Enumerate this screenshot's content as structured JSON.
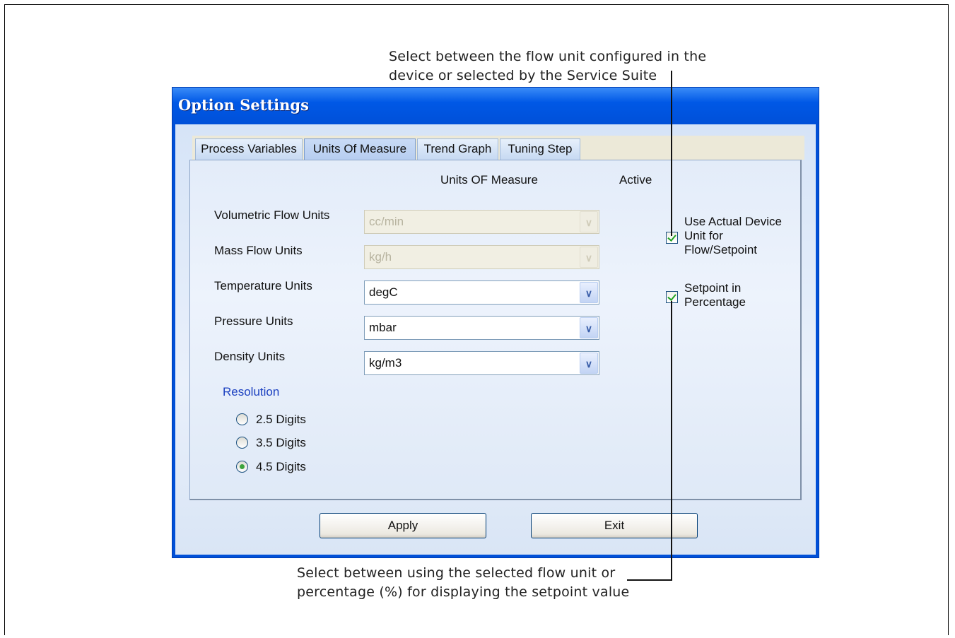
{
  "callouts": {
    "top_line1": "Select between the flow unit configured in the",
    "top_line2": "device or selected by the Service Suite",
    "bottom_line1": "Select between using the selected flow unit or",
    "bottom_line2": "percentage (%) for displaying the setpoint value"
  },
  "dialog": {
    "title": "Option Settings",
    "tabs": [
      {
        "label": "Process Variables"
      },
      {
        "label": "Units Of Measure"
      },
      {
        "label": "Trend Graph"
      },
      {
        "label": "Tuning Step"
      }
    ],
    "active_tab": "Units Of Measure",
    "headers": {
      "units": "Units OF Measure",
      "active": "Active"
    },
    "rows": [
      {
        "label": "Volumetric Flow Units",
        "value": "cc/min",
        "enabled": false
      },
      {
        "label": "Mass Flow Units",
        "value": "kg/h",
        "enabled": false
      },
      {
        "label": "Temperature Units",
        "value": "degC",
        "enabled": true
      },
      {
        "label": "Pressure Units",
        "value": "mbar",
        "enabled": true
      },
      {
        "label": "Density Units",
        "value": "kg/m3",
        "enabled": true
      }
    ],
    "checkboxes": [
      {
        "line1": "Use Actual Device",
        "line2": "Unit for",
        "line3": "Flow/Setpoint",
        "checked": true
      },
      {
        "line1": "Setpoint in",
        "line2": "Percentage",
        "checked": true
      }
    ],
    "resolution": {
      "label": "Resolution",
      "options": [
        {
          "label": "2.5 Digits",
          "selected": false
        },
        {
          "label": "3.5 Digits",
          "selected": false
        },
        {
          "label": "4.5 Digits",
          "selected": true
        }
      ]
    },
    "buttons": {
      "apply": "Apply",
      "exit": "Exit"
    }
  },
  "colors": {
    "title_bar": "#0050d8",
    "client_bg": "#e3ecf9",
    "resolution_label": "#1a3fc0",
    "check_mark": "#21a121"
  },
  "icons": [
    "dropdown-arrow-icon",
    "checkmark-icon",
    "radio-dot-icon"
  ]
}
